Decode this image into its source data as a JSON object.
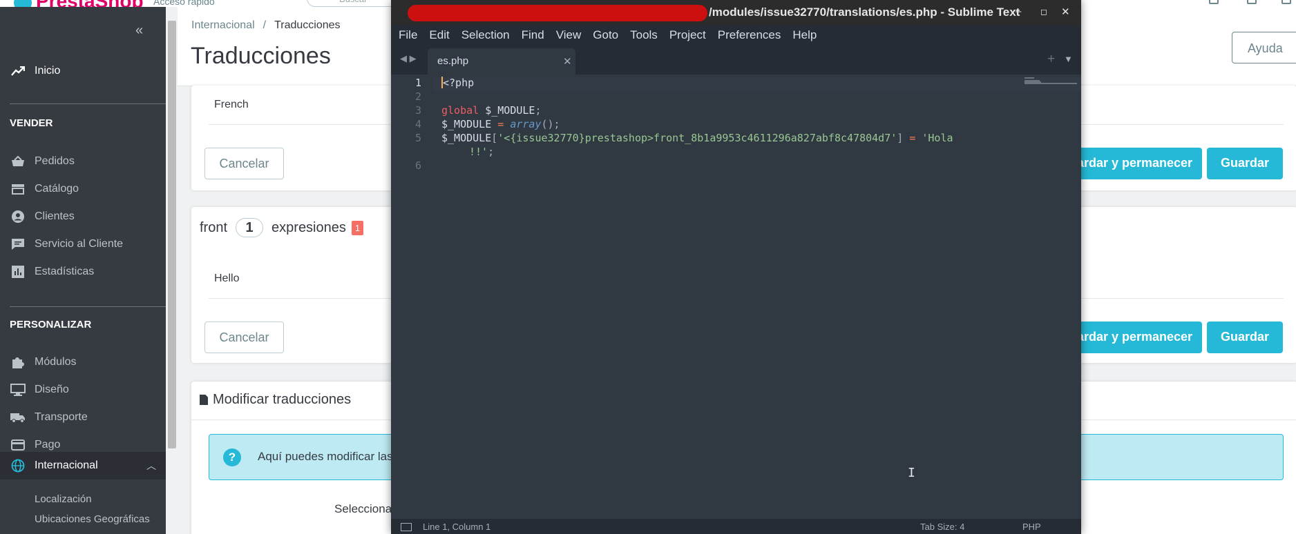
{
  "ps": {
    "logo": "PrestaShop",
    "header": {
      "quick_access": "Acceso rápido",
      "search_placeholder": "Buscar"
    },
    "sidebar": {
      "home": "Inicio",
      "sell_header": "VENDER",
      "sell_items": [
        "Pedidos",
        "Catálogo",
        "Clientes",
        "Servicio al Cliente",
        "Estadísticas"
      ],
      "customize_header": "PERSONALIZAR",
      "customize_items": [
        "Módulos",
        "Diseño",
        "Transporte",
        "Pago"
      ],
      "active_item": "Internacional",
      "submenu": [
        "Localización",
        "Ubicaciones Geográficas"
      ]
    },
    "breadcrumb": {
      "parent": "Internacional",
      "current": "Traducciones"
    },
    "page_title": "Traducciones",
    "help_button": "Ayuda",
    "card1": {
      "field": "French",
      "cancel": "Cancelar",
      "save_stay": "Guardar y permanecer",
      "save": "Guardar"
    },
    "domain": {
      "name": "front",
      "count": "1",
      "label": "expresiones",
      "missing": "1"
    },
    "card2": {
      "field": "Hello",
      "cancel": "Cancelar",
      "save_stay": "Guardar y permanecer",
      "save": "Guardar"
    },
    "modify": {
      "title": "Modificar traducciones",
      "info": "Aquí puedes modificar las traducciones de todo el texto incluido en PrestaShop.",
      "select_label": "Selecciona el tipo de traducción"
    }
  },
  "sublime": {
    "title": "/modules/issue32770/translations/es.php - Sublime Text",
    "window_buttons": [
      "–",
      "◻",
      "✕"
    ],
    "menu": [
      "File",
      "Edit",
      "Selection",
      "Find",
      "View",
      "Goto",
      "Tools",
      "Project",
      "Preferences",
      "Help"
    ],
    "tab": {
      "name": "es.php",
      "close": "✕"
    },
    "line_numbers": [
      "1",
      "2",
      "3",
      "4",
      "5",
      "6"
    ],
    "code": {
      "l1": "<?php",
      "l3_kw": "global",
      "l3_var": "$_MODULE",
      "l4_var": "$_MODULE",
      "l4_op": "=",
      "l4_fn": "array",
      "l5_var": "$_MODULE",
      "l5_key": "'<{issue32770}prestashop>front_8b1a9953c4611296a827abf8c47804d7'",
      "l5_op": "=",
      "l5_val_a": "'Hola",
      "l5_val_b": "!!'"
    },
    "status": {
      "position": "Line 1, Column 1",
      "tab_size": "Tab Size: 4",
      "syntax": "PHP"
    }
  }
}
